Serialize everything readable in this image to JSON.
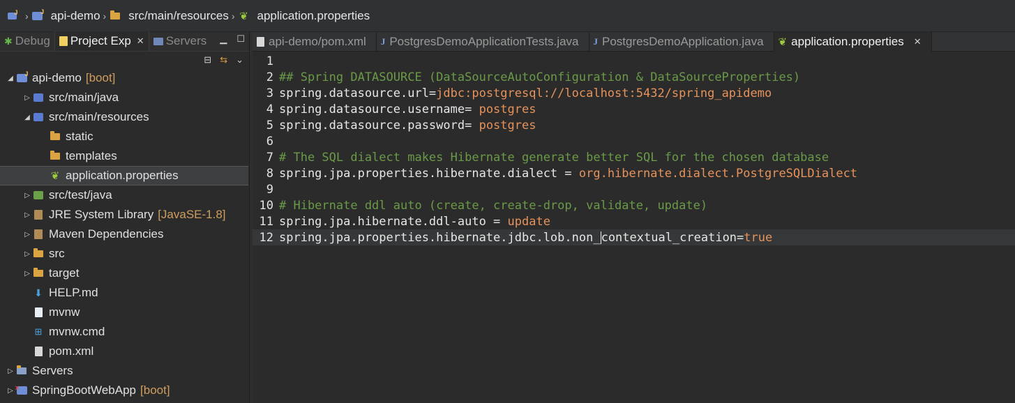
{
  "breadcrumb": [
    {
      "label": ""
    },
    {
      "label": "api-demo"
    },
    {
      "label": "src/main/resources"
    },
    {
      "label": "application.properties"
    }
  ],
  "left_tabs": [
    {
      "label": "Debug"
    },
    {
      "label": "Project Exp"
    },
    {
      "label": "Servers"
    }
  ],
  "tree": [
    {
      "label": "api-demo",
      "deco": "[boot]"
    },
    {
      "label": "src/main/java"
    },
    {
      "label": "src/main/resources"
    },
    {
      "label": "static"
    },
    {
      "label": "templates"
    },
    {
      "label": "application.properties"
    },
    {
      "label": "src/test/java"
    },
    {
      "label": "JRE System Library",
      "deco": "[JavaSE-1.8]"
    },
    {
      "label": "Maven Dependencies"
    },
    {
      "label": "src"
    },
    {
      "label": "target"
    },
    {
      "label": "HELP.md"
    },
    {
      "label": "mvnw"
    },
    {
      "label": "mvnw.cmd"
    },
    {
      "label": "pom.xml"
    },
    {
      "label": "Servers"
    },
    {
      "label": "SpringBootWebApp",
      "deco": "[boot]"
    }
  ],
  "editor_tabs": [
    {
      "label": "api-demo/pom.xml"
    },
    {
      "label": "PostgresDemoApplicationTests.java"
    },
    {
      "label": "PostgresDemoApplication.java"
    },
    {
      "label": "application.properties"
    }
  ],
  "code": [
    {
      "num": "1",
      "key": "",
      "val": "",
      "comment": ""
    },
    {
      "num": "2",
      "key": "",
      "val": "",
      "comment": "## Spring DATASOURCE (DataSourceAutoConfiguration & DataSourceProperties)"
    },
    {
      "num": "3",
      "key": "spring.datasource.url=",
      "val": "jdbc:postgresql://localhost:5432/spring_apidemo",
      "comment": ""
    },
    {
      "num": "4",
      "key": "spring.datasource.username= ",
      "val": "postgres",
      "comment": ""
    },
    {
      "num": "5",
      "key": "spring.datasource.password= ",
      "val": "postgres",
      "comment": ""
    },
    {
      "num": "6",
      "key": "",
      "val": "",
      "comment": ""
    },
    {
      "num": "7",
      "key": "",
      "val": "",
      "comment": "# The SQL dialect makes Hibernate generate better SQL for the chosen database"
    },
    {
      "num": "8",
      "key": "spring.jpa.properties.hibernate.dialect = ",
      "val": "org.hibernate.dialect.PostgreSQLDialect",
      "comment": ""
    },
    {
      "num": "9",
      "key": "",
      "val": "",
      "comment": ""
    },
    {
      "num": "10",
      "key": "",
      "val": "",
      "comment": "# Hibernate ddl auto (create, create-drop, validate, update)"
    },
    {
      "num": "11",
      "key": "spring.jpa.hibernate.ddl-auto = ",
      "val": "update",
      "comment": ""
    },
    {
      "num": "12",
      "key_a": "spring.jpa.properties.hibernate.jdbc.lob.non_",
      "key_b": "contextual_creation=",
      "val": "true",
      "comment": ""
    }
  ]
}
